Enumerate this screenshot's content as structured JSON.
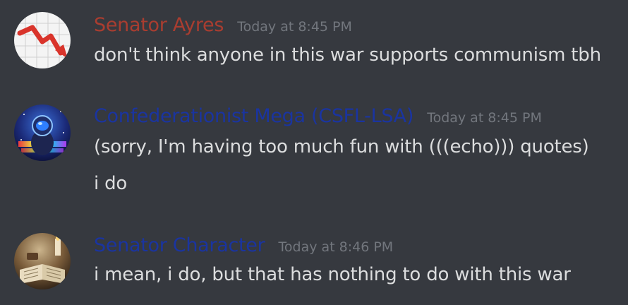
{
  "messages": [
    {
      "username": "Senator Ayres",
      "username_color": "#a93d30",
      "timestamp": "Today at 8:45 PM",
      "avatar_icon": "declining-chart-arrow-icon",
      "lines": [
        "don't think anyone in this war supports communism tbh"
      ]
    },
    {
      "username": "Confederationist Mega (CSFL-LSA)",
      "username_color": "#1a34a0",
      "timestamp": "Today at 8:45 PM",
      "avatar_icon": "astronaut-icon",
      "lines": [
        "(sorry, I'm having too much fun with (((echo))) quotes)",
        "i do"
      ]
    },
    {
      "username": "Senator Character",
      "username_color": "#1a34a0",
      "timestamp": "Today at 8:46 PM",
      "avatar_icon": "book-candle-icon",
      "lines": [
        "i mean, i do, but that has nothing to do with this war"
      ]
    }
  ]
}
